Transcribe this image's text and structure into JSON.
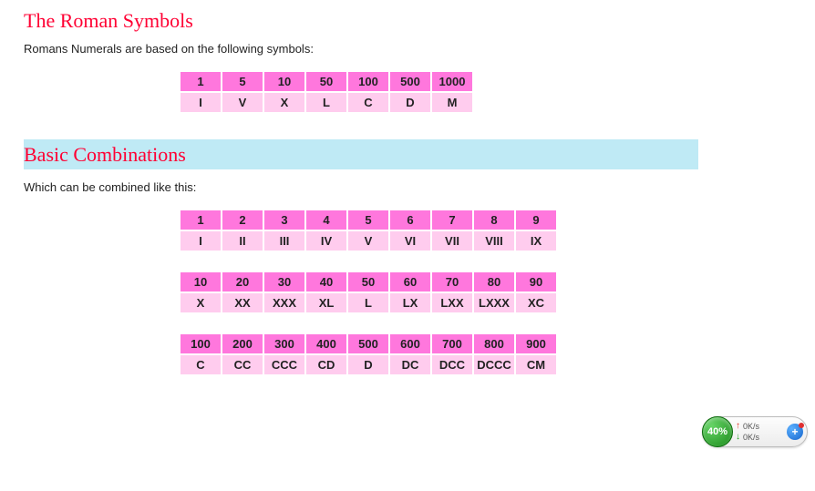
{
  "section1": {
    "title": "The Roman Symbols",
    "intro": "Romans Numerals are based on the following symbols:"
  },
  "symbols": {
    "nums": [
      "1",
      "5",
      "10",
      "50",
      "100",
      "500",
      "1000"
    ],
    "roms": [
      "I",
      "V",
      "X",
      "L",
      "C",
      "D",
      "M"
    ]
  },
  "section2": {
    "title": "Basic Combinations",
    "intro": "Which can be combined like this:"
  },
  "combo1": {
    "nums": [
      "1",
      "2",
      "3",
      "4",
      "5",
      "6",
      "7",
      "8",
      "9"
    ],
    "roms": [
      "I",
      "II",
      "III",
      "IV",
      "V",
      "VI",
      "VII",
      "VIII",
      "IX"
    ]
  },
  "combo2": {
    "nums": [
      "10",
      "20",
      "30",
      "40",
      "50",
      "60",
      "70",
      "80",
      "90"
    ],
    "roms": [
      "X",
      "XX",
      "XXX",
      "XL",
      "L",
      "LX",
      "LXX",
      "LXXX",
      "XC"
    ]
  },
  "combo3": {
    "nums": [
      "100",
      "200",
      "300",
      "400",
      "500",
      "600",
      "700",
      "800",
      "900"
    ],
    "roms": [
      "C",
      "CC",
      "CCC",
      "CD",
      "D",
      "DC",
      "DCC",
      "DCCC",
      "CM"
    ]
  },
  "widget": {
    "percent": "40%",
    "up": "0K/s",
    "down": "0K/s"
  }
}
